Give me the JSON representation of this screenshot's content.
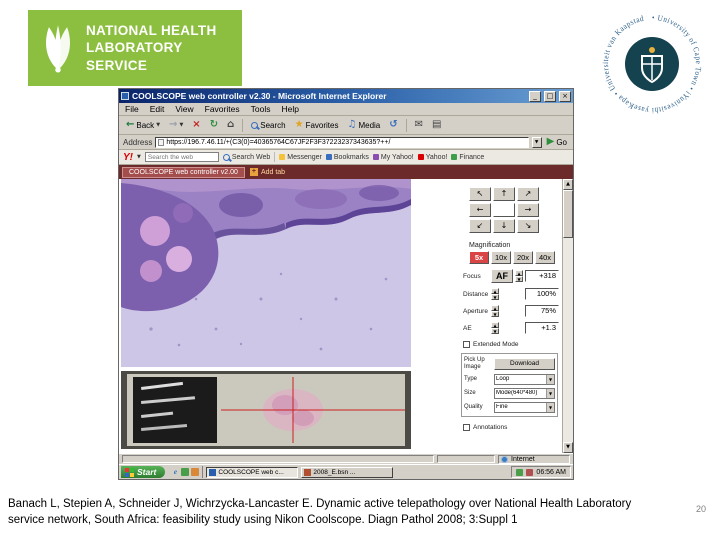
{
  "icons": {
    "minimize": "_",
    "maximize": "□",
    "close": "×",
    "back": "←",
    "forward": "→",
    "stop": "×",
    "refresh": "↻",
    "home": "⌂",
    "star": "★",
    "media": "♫",
    "history": "↺",
    "mail": "✉",
    "print": "▤",
    "go": "▶",
    "caret": "▼",
    "plus": "+",
    "spin_up": "▲",
    "spin_down": "▼",
    "scroll_up": "▲",
    "scroll_down": "▼"
  },
  "nhls_logo": {
    "line1": "NATIONAL HEALTH",
    "line2": "LABORATORY SERVICE",
    "green": "#8cbf3f"
  },
  "uct_seal": {
    "ring_text": "• University of Cape Town • iYunivesithi yaseKapa • Universiteit van Kaapstad"
  },
  "browser": {
    "window_title": "COOLSCOPE web controller v2.30 - Microsoft Internet Explorer",
    "menu_items": [
      "File",
      "Edit",
      "View",
      "Favorites",
      "Tools",
      "Help"
    ],
    "toolbar": {
      "back": "Back",
      "search": "Search",
      "favorites": "Favorites",
      "media": "Media"
    },
    "address": {
      "label": "Address",
      "url": "https://196.7.46.11/+(C3(0)=40365764C67JF2F3F37223237343635?++/",
      "go": "Go"
    },
    "yahoo": {
      "logo": "Y!",
      "search_text": "Search the web",
      "search_button": "Search Web",
      "items": [
        "Messenger",
        "Bookmarks",
        "My Yahoo!",
        "Yahoo!",
        "Finance"
      ]
    },
    "tabs": {
      "active": "COOLSCOPE web controller v2.00",
      "add": "Add tab"
    },
    "status_zone": "Internet"
  },
  "controller": {
    "arrows": [
      "↖",
      "↑",
      "↗",
      "←",
      "→",
      "↙",
      "↓",
      "↘"
    ],
    "magnification_label": "Magnification",
    "mag_buttons": [
      "5x",
      "10x",
      "20x",
      "40x"
    ],
    "active_mag": "5x",
    "focus_label": "Focus",
    "af": "AF",
    "focus_value": "+318",
    "distance_label": "Distance",
    "distance_value": "100%",
    "aperture_label": "Aperture",
    "aperture_value": "75%",
    "ae_label": "AE",
    "ae_value": "+1.3",
    "extended_mode": "Extended Mode",
    "pickup_line1": "Pick Up",
    "pickup_line2": "Image",
    "download": "Download",
    "type_label": "Type",
    "type_value": "Loop",
    "size_label": "Size",
    "size_value": "Mode(640*480)",
    "quality_label": "Quality",
    "quality_value": "Fine",
    "annotations": "Annotations"
  },
  "taskbar": {
    "start": "Start",
    "tasks": [
      "COOLSCOPE web c...",
      "2008_E.bsn ..."
    ],
    "time": "06:56 AM"
  },
  "slide": {
    "citation_line1": "Banach L, Stepien A, Schneider J, Wichrzycka-Lancaster E. Dynamic active telepathology over National Health Laboratory",
    "citation_line2": "service network, South Africa: feasibility study using Nikon Coolscope. Diagn Pathol 2008; 3:Suppl 1",
    "page_number": "20"
  }
}
